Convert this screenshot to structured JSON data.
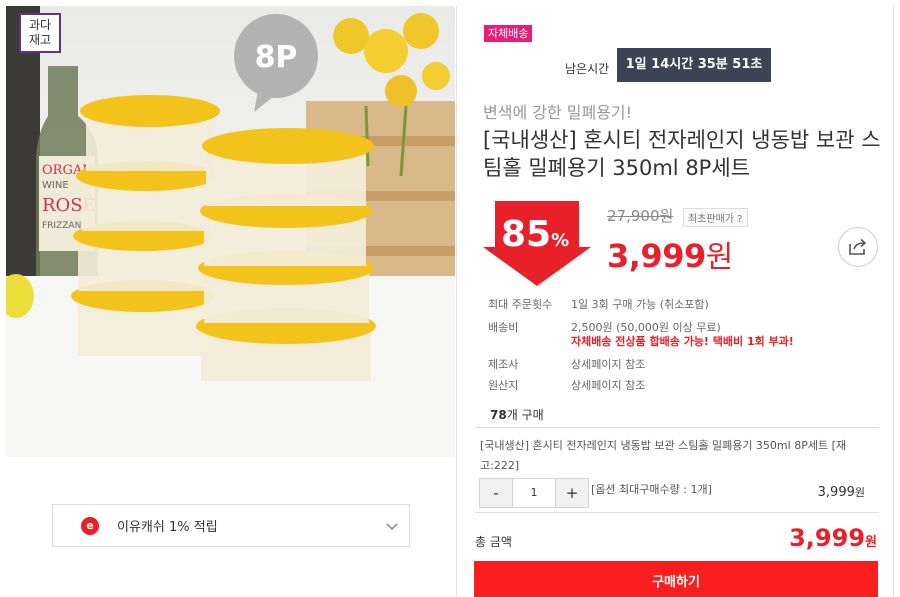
{
  "product_image": {
    "stock_badge_line1": "과다",
    "stock_badge_line2": "재고",
    "count_bubble": "8P",
    "jar_label_line1": "ORGAN",
    "jar_label_line2": "WINE",
    "jar_label_line3": "ROSÉ",
    "jar_label_line4": "FRIZZAN"
  },
  "cashback": {
    "icon_letter": "e",
    "label": "이유캐쉬 1% 적립"
  },
  "panel": {
    "shipping_badge": "자체배송",
    "timer_label": "남은시간",
    "timer_value": "1일 14시간 35분 51초",
    "subtitle": "변색에 강한 밀폐용기!",
    "title": "[국내생산] 혼시티 전자레인지 냉동밥 보관 스팀홀 밀폐용기 350ml 8P세트",
    "discount_number": "85",
    "discount_unit": "%",
    "original_price": "27,900원",
    "lowest_price_tag": "최초판매가 ?",
    "price_number": "3,999",
    "price_unit": "원"
  },
  "info_rows": [
    {
      "key": "최대 주문횟수",
      "value": "1일 3회 구매 가능 (취소포함)"
    },
    {
      "key": "배송비",
      "value": "2,500원 (50,000원 이상 무료)",
      "warning": "자체배송 전상품 합배송 가능! 택배비 1회 부과!"
    },
    {
      "key": "제조사",
      "value": "상세페이지 참조"
    },
    {
      "key": "원산지",
      "value": "상세페이지 참조"
    }
  ],
  "buy_count": {
    "number": "78",
    "suffix": "개 구매"
  },
  "option": {
    "name": "[국내생산] 혼시티 전자레인지 냉동밥 보관 스팀홀 밀폐용기 350ml 8P세트 [재고:222]",
    "minus": "-",
    "quantity": "1",
    "plus": "+",
    "max_note": "[옵션 최대구매수량 : 1개]",
    "price_number": "3,999",
    "price_unit": "원"
  },
  "total": {
    "label": "총 금액",
    "price_number": "3,999",
    "price_unit": "원"
  },
  "buy_button": "구매하기",
  "colors": {
    "accent_red": "#e8202a",
    "buy_button": "#fa1e1e",
    "timer_bg": "#3a4455",
    "shipping_badge": "#e61e78",
    "stock_badge_border": "#6a2c8a",
    "container_lid": "#f2c31a"
  }
}
